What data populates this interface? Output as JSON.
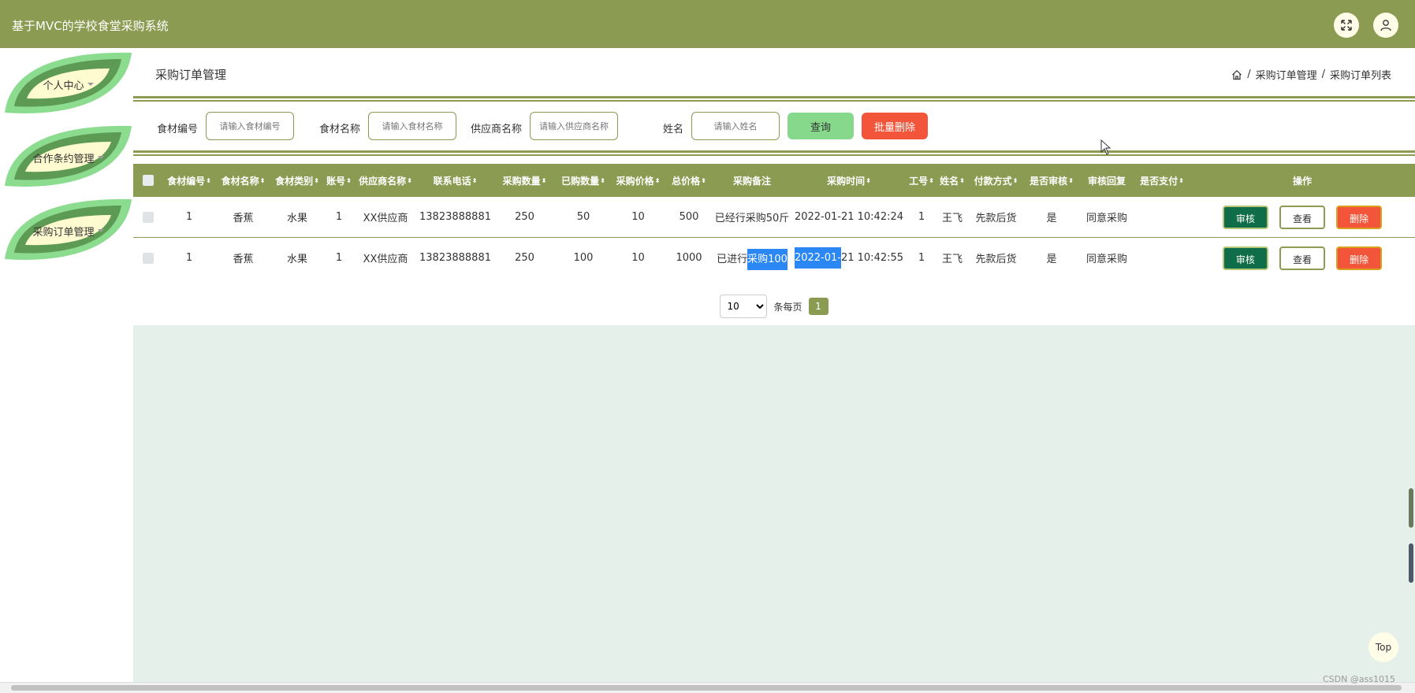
{
  "app": {
    "title": "基于MVC的学校食堂采购系统"
  },
  "header_icons": {
    "fullscreen": "fullscreen-icon",
    "user": "user-icon"
  },
  "sidebar": {
    "items": [
      {
        "label": "个人中心"
      },
      {
        "label": "合作条约管理"
      },
      {
        "label": "采购订单管理"
      }
    ]
  },
  "page": {
    "title": "采购订单管理",
    "breadcrumb": [
      "采购订单管理",
      "采购订单列表"
    ],
    "breadcrumb_sep": "/"
  },
  "search": {
    "fields": [
      {
        "label": "食材编号",
        "placeholder": "请输入食材编号"
      },
      {
        "label": "食材名称",
        "placeholder": "请输入食材名称"
      },
      {
        "label": "供应商名称",
        "placeholder": "请输入供应商名称"
      },
      {
        "label": "姓名",
        "placeholder": "请输入姓名"
      }
    ],
    "query_label": "查询",
    "batch_delete_label": "批量删除"
  },
  "table": {
    "columns": [
      "食材编号",
      "食材名称",
      "食材类别",
      "账号",
      "供应商名称",
      "联系电话",
      "采购数量",
      "已购数量",
      "采购价格",
      "总价格",
      "采购备注",
      "采购时间",
      "工号",
      "姓名",
      "付款方式",
      "是否审核",
      "审核回复",
      "是否支付",
      "操作"
    ],
    "actions": {
      "audit": "审核",
      "view": "查看",
      "delete": "删除"
    },
    "rows": [
      {
        "code": "1",
        "name": "香蕉",
        "category": "水果",
        "account": "1",
        "supplier": "XX供应商",
        "phone": "13823888881",
        "qty": "250",
        "bought": "50",
        "price": "10",
        "total": "500",
        "note": "已经行采购50斤",
        "note_pre": "",
        "note_sel": "",
        "time": "2022-01-21 10:42:24",
        "time_sel": "",
        "time_post": "",
        "emp": "1",
        "person": "王飞",
        "pay": "先款后货",
        "audited": "是",
        "reply": "同意采购",
        "paid": ""
      },
      {
        "code": "1",
        "name": "香蕉",
        "category": "水果",
        "account": "1",
        "supplier": "XX供应商",
        "phone": "13823888881",
        "qty": "250",
        "bought": "100",
        "price": "10",
        "total": "1000",
        "note": "",
        "note_pre": "已进行",
        "note_sel": "采购100",
        "time": "",
        "time_sel": "2022-01-",
        "time_post": "21 10:42:55",
        "emp": "1",
        "person": "王飞",
        "pay": "先款后货",
        "audited": "是",
        "reply": "同意采购",
        "paid": ""
      }
    ]
  },
  "pagination": {
    "page_size": "10",
    "per_page_label": "条每页",
    "current_page": "1"
  },
  "top_button": "Top",
  "watermark": "CSDN @ass1015",
  "colors": {
    "primary": "#8c9b52",
    "light_green": "#86d98a",
    "danger": "#f2553a",
    "audit": "#0f6e49",
    "page_bg": "#e6f0ea"
  }
}
